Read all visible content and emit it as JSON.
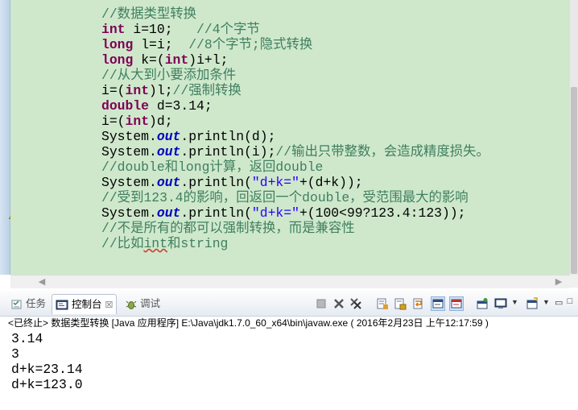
{
  "editor": {
    "lines": [
      [
        {
          "t": "//数据类型转换",
          "c": "cm"
        }
      ],
      [
        {
          "t": "int",
          "c": "kw"
        },
        {
          "t": " i=10;   "
        },
        {
          "t": "//4个字节",
          "c": "cm"
        }
      ],
      [
        {
          "t": "long",
          "c": "kw"
        },
        {
          "t": " l=i;  "
        },
        {
          "t": "//8个字节;隐式转换",
          "c": "cm"
        }
      ],
      [
        {
          "t": "long",
          "c": "kw"
        },
        {
          "t": " k=("
        },
        {
          "t": "int",
          "c": "kw"
        },
        {
          "t": ")i+l;"
        }
      ],
      [
        {
          "t": "//从大到小要添加条件",
          "c": "cm"
        }
      ],
      [
        {
          "t": "i=("
        },
        {
          "t": "int",
          "c": "kw"
        },
        {
          "t": ")l;"
        },
        {
          "t": "//强制转换",
          "c": "cm"
        }
      ],
      [
        {
          "t": "double",
          "c": "kw"
        },
        {
          "t": " d=3.14;"
        }
      ],
      [
        {
          "t": "i=("
        },
        {
          "t": "int",
          "c": "kw"
        },
        {
          "t": ")d;"
        }
      ],
      [
        {
          "t": "System."
        },
        {
          "t": "out",
          "c": "fld"
        },
        {
          "t": ".println(d);"
        }
      ],
      [
        {
          "t": "System."
        },
        {
          "t": "out",
          "c": "fld"
        },
        {
          "t": ".println(i);"
        },
        {
          "t": "//输出只带整数，会造成精度损失。",
          "c": "cm"
        }
      ],
      [
        {
          "t": "//double和long计算，返回double",
          "c": "cm"
        }
      ],
      [
        {
          "t": "System."
        },
        {
          "t": "out",
          "c": "fld"
        },
        {
          "t": ".println("
        },
        {
          "t": "\"d+k=\"",
          "c": "st"
        },
        {
          "t": "+(d+k));"
        }
      ],
      [
        {
          "t": "//受到123.4的影响，回返回一个double，受范围最大的影响",
          "c": "cm"
        }
      ],
      [
        {
          "t": "System."
        },
        {
          "t": "out",
          "c": "fld"
        },
        {
          "t": ".println("
        },
        {
          "t": "\"d+k=\"",
          "c": "st"
        },
        {
          "t": "+(100<99?123.4:123));"
        }
      ],
      [
        {
          "t": "//不是所有的都可以强制转换，而是兼容性",
          "c": "cm"
        }
      ],
      [
        {
          "t": "//比如",
          "c": "cm"
        },
        {
          "t": "int",
          "c": "cm squiggle"
        },
        {
          "t": "和string",
          "c": "cm"
        }
      ]
    ]
  },
  "console": {
    "tabs": [
      {
        "label": "任务",
        "icon": "tasks-icon"
      },
      {
        "label": "控制台",
        "icon": "console-icon",
        "close": "☒"
      },
      {
        "label": "调试",
        "icon": "debug-icon"
      }
    ],
    "status": "<已终止> 数据类型转换 [Java 应用程序] E:\\Java\\jdk1.7.0_60_x64\\bin\\javaw.exe ( 2016年2月23日 上午12:17:59 )",
    "output": [
      "3.14",
      "3",
      "d+k=23.14",
      "d+k=123.0"
    ],
    "toolbar": [
      "terminate-icon",
      "remove-launch-icon",
      "remove-all-icon",
      "clear-console-icon",
      "scroll-lock-icon",
      "word-wrap-icon",
      "show-on-stdout-icon",
      "show-on-stderr-icon",
      "pin-console-icon",
      "display-console-icon",
      "open-console-icon"
    ]
  },
  "colors": {
    "editor_background": "#cfe8cc",
    "keyword": "#7f0055",
    "comment": "#3f7f5f",
    "string": "#2a00ff",
    "field": "#0000c0"
  }
}
